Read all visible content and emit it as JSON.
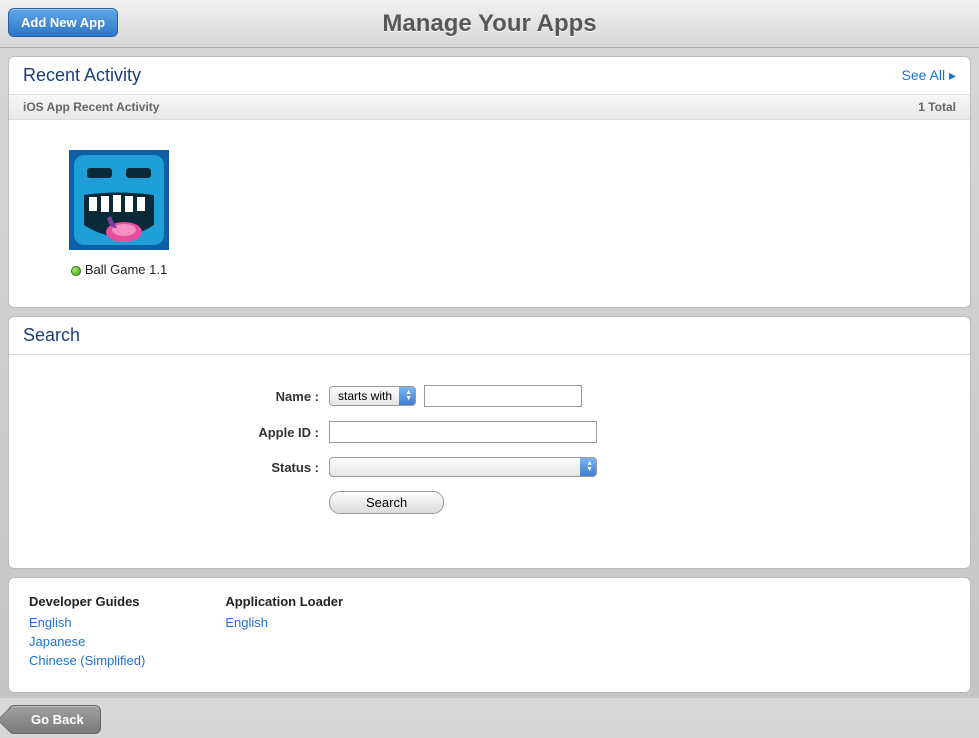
{
  "header": {
    "add_button": "Add New App",
    "title": "Manage Your Apps"
  },
  "recent": {
    "title": "Recent Activity",
    "see_all": "See All",
    "subheader_left": "iOS App Recent Activity",
    "subheader_right": "1 Total",
    "apps": [
      {
        "name": "Ball Game 1.1",
        "status_color": "#3da616"
      }
    ]
  },
  "search": {
    "title": "Search",
    "labels": {
      "name": "Name :",
      "apple_id": "Apple ID :",
      "status": "Status :"
    },
    "name_match_option": "starts with",
    "name_value": "",
    "apple_id_value": "",
    "status_value": "",
    "button": "Search"
  },
  "footer": {
    "dev_guides_title": "Developer Guides",
    "dev_guides_links": [
      "English",
      "Japanese",
      "Chinese (Simplified)"
    ],
    "app_loader_title": "Application Loader",
    "app_loader_links": [
      "English"
    ]
  },
  "nav": {
    "go_back": "Go Back"
  }
}
